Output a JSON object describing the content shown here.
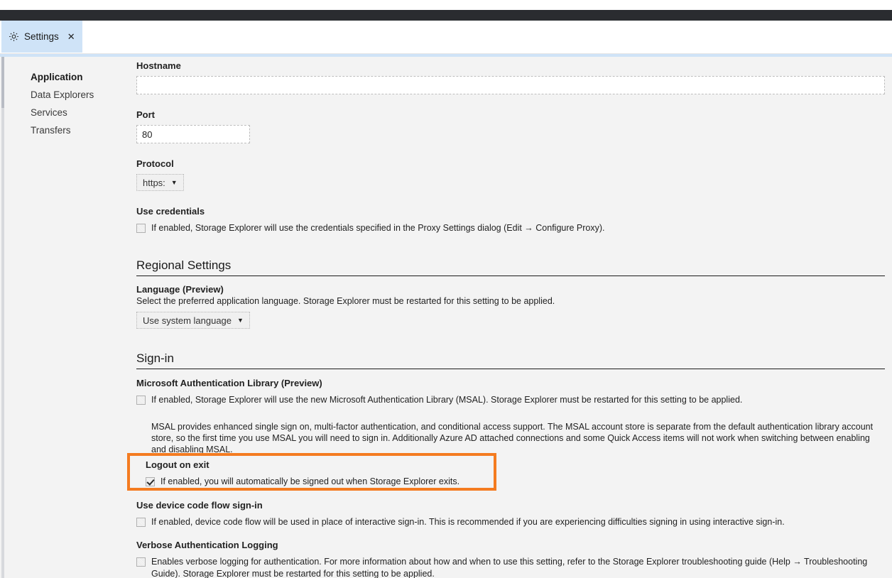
{
  "window": {
    "tab": {
      "icon": "gear-icon",
      "label": "Settings",
      "close": "✕"
    }
  },
  "sidebar": {
    "items": [
      {
        "label": "Application",
        "active": true
      },
      {
        "label": "Data Explorers",
        "active": false
      },
      {
        "label": "Services",
        "active": false
      },
      {
        "label": "Transfers",
        "active": false
      }
    ]
  },
  "proxy": {
    "hostname_label": "Hostname",
    "hostname_value": "",
    "hostname_placeholder": "",
    "port_label": "Port",
    "port_value": "80",
    "protocol_label": "Protocol",
    "protocol_value": "https:",
    "protocol_caret": "▼",
    "credentials_label": "Use credentials",
    "credentials_text": "If enabled, Storage Explorer will use the credentials specified in the Proxy Settings dialog (Edit → Configure Proxy).",
    "credentials_checked": false
  },
  "regional": {
    "heading": "Regional Settings",
    "language_label": "Language (Preview)",
    "language_desc": "Select the preferred application language. Storage Explorer must be restarted for this setting to be applied.",
    "language_value": "Use system language",
    "language_caret": "▼"
  },
  "signin": {
    "heading": "Sign-in",
    "msal_label": "Microsoft Authentication Library (Preview)",
    "msal_text": "If enabled, Storage Explorer will use the new Microsoft Authentication Library (MSAL). Storage Explorer must be restarted for this setting to be applied.",
    "msal_checked": false,
    "msal_para": "MSAL provides enhanced single sign on, multi-factor authentication, and conditional access support. The MSAL account store is separate from the default authentication library account store, so the first time you use MSAL you will need to sign in. Additionally Azure AD attached connections and some Quick Access items will not work when switching between enabling and disabling MSAL.",
    "logout_label": "Logout on exit",
    "logout_text": "If enabled, you will automatically be signed out when Storage Explorer exits.",
    "logout_checked": true,
    "devicecode_label": "Use device code flow sign-in",
    "devicecode_text": "If enabled, device code flow will be used in place of interactive sign-in. This is recommended if you are experiencing difficulties signing in using interactive sign-in.",
    "devicecode_checked": false,
    "verbose_label": "Verbose Authentication Logging",
    "verbose_text": "Enables verbose logging for authentication. For more information about how and when to use this setting, refer to the Storage Explorer troubleshooting guide (Help → Troubleshooting Guide). Storage Explorer must be restarted for this setting to be applied.",
    "verbose_checked": false
  },
  "colors": {
    "titlebar": "#2a2c30",
    "tab_active": "#cfe3f7",
    "content_bg": "#f3f3f3",
    "highlight": "#f47b20"
  }
}
